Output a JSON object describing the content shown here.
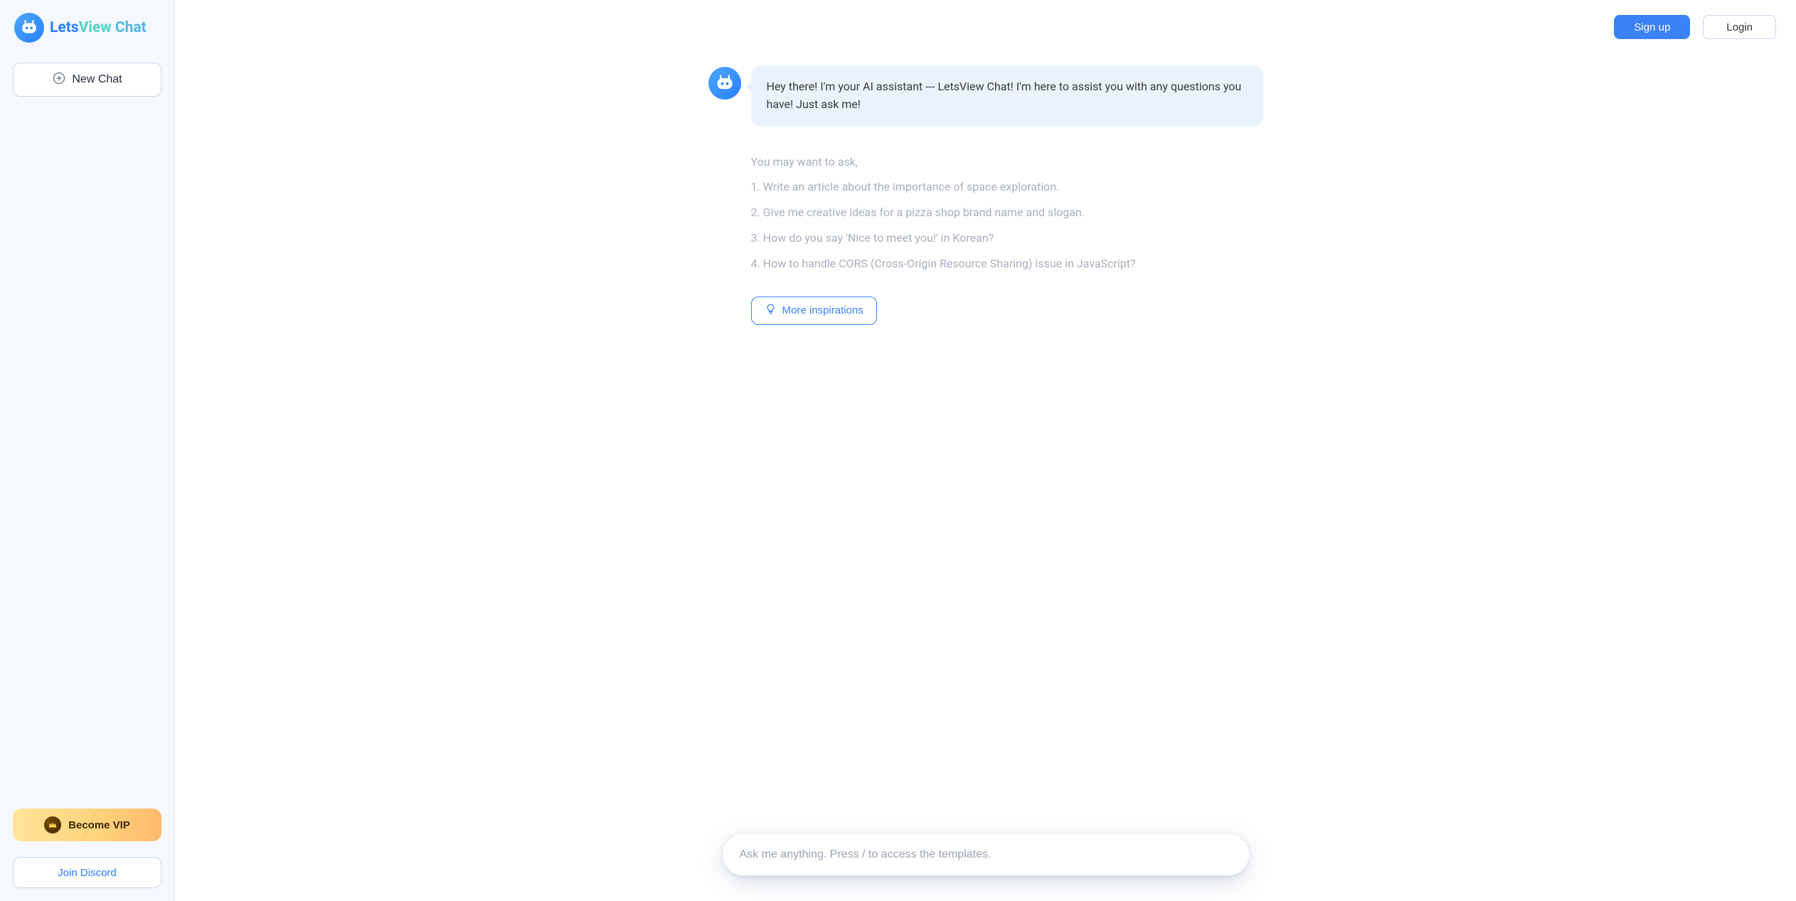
{
  "brand": {
    "name_part1": "Lets",
    "name_part2": "View",
    "name_part3": " Chat"
  },
  "sidebar": {
    "new_chat_label": "New Chat",
    "vip_label": "Become VIP",
    "discord_label": "Join Discord"
  },
  "topbar": {
    "signup_label": "Sign up",
    "login_label": "Login"
  },
  "chat": {
    "greeting": "Hey there! I'm your AI assistant --- LetsView Chat! I'm here to assist you with any questions you have! Just ask me!"
  },
  "suggestions": {
    "heading": "You may want to ask,",
    "items": [
      "1. Write an article about the importance of space exploration.",
      "2. Give me creative ideas for a pizza shop brand name and slogan.",
      "3. How do you say 'Nice to meet you!' in Korean?",
      "4. How to handle CORS (Cross-Origin Resource Sharing) issue in JavaScript?"
    ],
    "more_label": "More inspirations"
  },
  "composer": {
    "placeholder": "Ask me anything. Press / to access the templates."
  }
}
